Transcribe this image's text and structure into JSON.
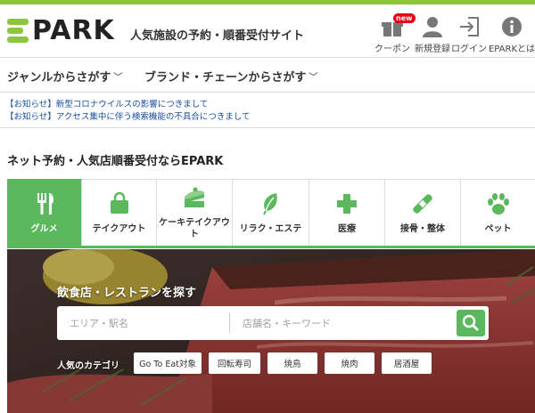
{
  "brand": {
    "logo_text": "PARK",
    "tagline": "人気施設の予約・順番受付サイト",
    "accent": "#8cc63f",
    "green": "#5cb85c"
  },
  "header_nav": [
    {
      "label": "クーポン",
      "icon": "gift-icon",
      "badge": "new"
    },
    {
      "label": "新規登録",
      "icon": "user-icon"
    },
    {
      "label": "ログイン",
      "icon": "login-icon"
    },
    {
      "label": "EPARKとは",
      "icon": "info-icon"
    }
  ],
  "subnav": [
    {
      "label": "ジャンルからさがす"
    },
    {
      "label": "ブランド・チェーンからさがす"
    }
  ],
  "notices": [
    "【お知らせ】新型コロナウイルスの影響につきまして",
    "【お知らせ】アクセス集中に伴う検索機能の不具合につきまして"
  ],
  "section_title": "ネット予約・人気店順番受付ならEPARK",
  "tabs": [
    {
      "label": "グルメ",
      "icon": "fork-knife-icon",
      "active": true
    },
    {
      "label": "テイクアウト",
      "icon": "bag-icon"
    },
    {
      "label": "ケーキテイクアウト",
      "icon": "cake-icon"
    },
    {
      "label": "リラク・エステ",
      "icon": "leaf-icon"
    },
    {
      "label": "医療",
      "icon": "medical-cross-icon"
    },
    {
      "label": "接骨・整体",
      "icon": "bandage-icon"
    },
    {
      "label": "ペット",
      "icon": "paw-icon"
    }
  ],
  "hero": {
    "title": "飲食店・レストランを探す",
    "area_placeholder": "エリア・駅名",
    "keyword_placeholder": "店舗名・キーワード",
    "popular_label": "人気のカテゴリ",
    "chips": [
      "Go To Eat対象",
      "回転寿司",
      "焼鳥",
      "焼肉",
      "居酒屋"
    ]
  },
  "colors": {
    "notice_link": "#1a4fa0",
    "badge": "#e60012"
  }
}
